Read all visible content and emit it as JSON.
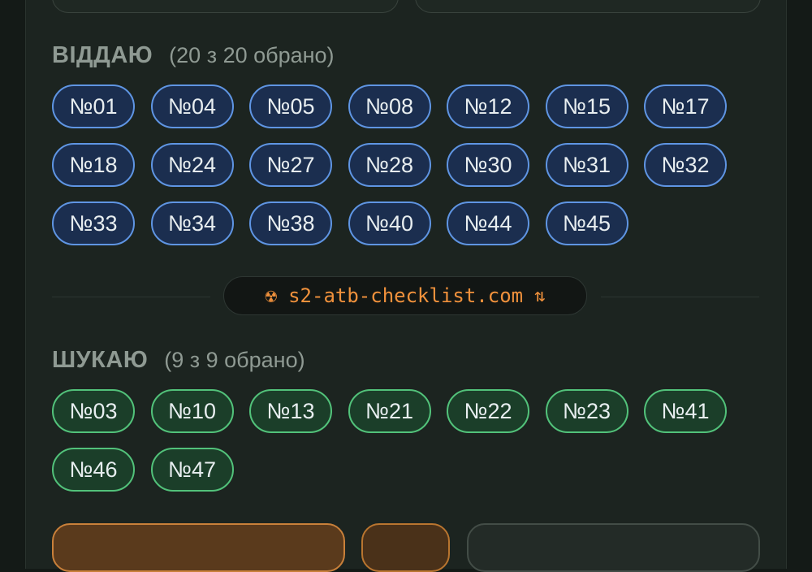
{
  "give": {
    "title": "ВІДДАЮ",
    "count": "(20 з 20 обрано)",
    "items": [
      "№01",
      "№04",
      "№05",
      "№08",
      "№12",
      "№15",
      "№17",
      "№18",
      "№24",
      "№27",
      "№28",
      "№30",
      "№31",
      "№32",
      "№33",
      "№34",
      "№38",
      "№40",
      "№44",
      "№45"
    ]
  },
  "site": {
    "url": "s2-atb-checklist.com",
    "icon": "radiation-icon",
    "swap_icon": "swap-arrows-icon"
  },
  "want": {
    "title": "ШУКАЮ",
    "count": "(9 з 9 обрано)",
    "items": [
      "№03",
      "№10",
      "№13",
      "№21",
      "№22",
      "№23",
      "№41",
      "№46",
      "№47"
    ]
  },
  "colors": {
    "give_fill": "#1b2e4f",
    "give_border": "#5f95e3",
    "want_fill": "#1b3e29",
    "want_border": "#52c27a",
    "accent": "#f0913c"
  }
}
